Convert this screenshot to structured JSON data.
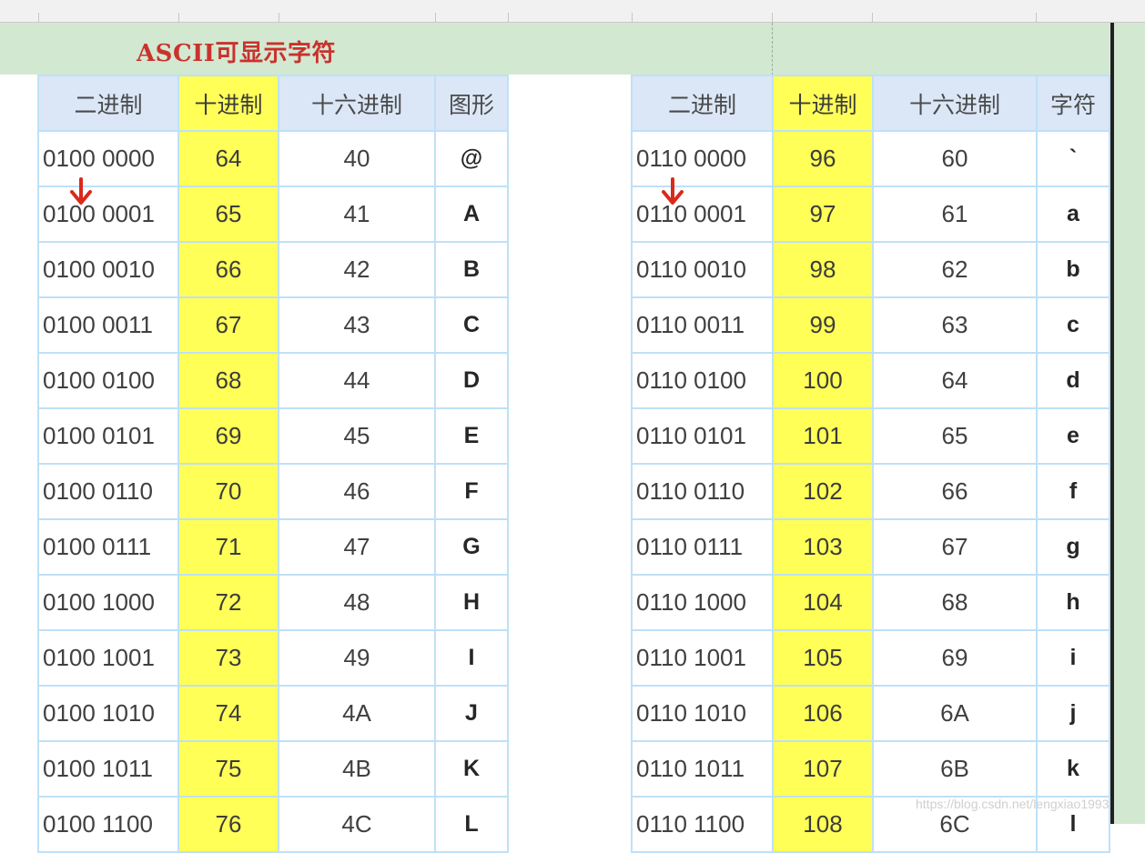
{
  "title": "ASCII可显示字符",
  "left_table": {
    "headers": [
      "二进制",
      "十进制",
      "十六进制",
      "图形"
    ],
    "rows": [
      [
        "0100 0000",
        "64",
        "40",
        "@"
      ],
      [
        "0100 0001",
        "65",
        "41",
        "A"
      ],
      [
        "0100 0010",
        "66",
        "42",
        "B"
      ],
      [
        "0100 0011",
        "67",
        "43",
        "C"
      ],
      [
        "0100 0100",
        "68",
        "44",
        "D"
      ],
      [
        "0100 0101",
        "69",
        "45",
        "E"
      ],
      [
        "0100 0110",
        "70",
        "46",
        "F"
      ],
      [
        "0100 0111",
        "71",
        "47",
        "G"
      ],
      [
        "0100 1000",
        "72",
        "48",
        "H"
      ],
      [
        "0100 1001",
        "73",
        "49",
        "I"
      ],
      [
        "0100 1010",
        "74",
        "4A",
        "J"
      ],
      [
        "0100 1011",
        "75",
        "4B",
        "K"
      ],
      [
        "0100 1100",
        "76",
        "4C",
        "L"
      ]
    ]
  },
  "right_table": {
    "headers": [
      "二进制",
      "十进制",
      "十六进制",
      "字符"
    ],
    "rows": [
      [
        "0110 0000",
        "96",
        "60",
        "`"
      ],
      [
        "0110 0001",
        "97",
        "61",
        "a"
      ],
      [
        "0110 0010",
        "98",
        "62",
        "b"
      ],
      [
        "0110 0011",
        "99",
        "63",
        "c"
      ],
      [
        "0110 0100",
        "100",
        "64",
        "d"
      ],
      [
        "0110 0101",
        "101",
        "65",
        "e"
      ],
      [
        "0110 0110",
        "102",
        "66",
        "f"
      ],
      [
        "0110 0111",
        "103",
        "67",
        "g"
      ],
      [
        "0110 1000",
        "104",
        "68",
        "h"
      ],
      [
        "0110 1001",
        "105",
        "69",
        "i"
      ],
      [
        "0110 1010",
        "106",
        "6A",
        "j"
      ],
      [
        "0110 1011",
        "107",
        "6B",
        "k"
      ],
      [
        "0110 1100",
        "108",
        "6C",
        "l"
      ]
    ]
  },
  "annotations": {
    "marker_icon": "arrow-down-icon",
    "marker_color": "#d92a1c"
  },
  "watermark": "https://blog.csdn.net/lengxiao1993",
  "colors": {
    "banner": "#d3e8d1",
    "header": "#dbe7f7",
    "decimal_highlight": "#ffff58",
    "grid": "#bfe0f8",
    "title": "#c9322d"
  }
}
